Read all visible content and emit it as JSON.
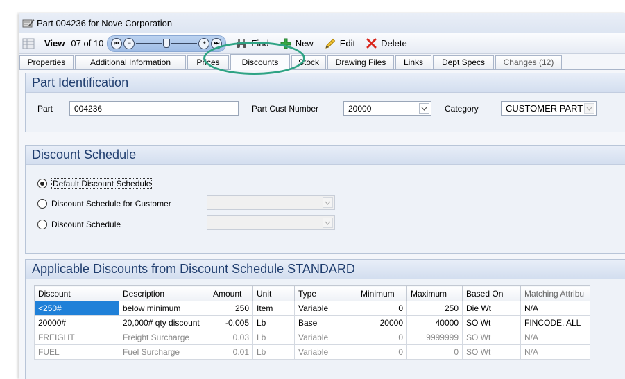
{
  "window": {
    "title": "Part 004236 for Nove Corporation"
  },
  "toolbar": {
    "view_label": "View",
    "record_position": "07 of 10",
    "find_label": "Find",
    "new_label": "New",
    "edit_label": "Edit",
    "delete_label": "Delete"
  },
  "tabs": [
    {
      "label": "Properties"
    },
    {
      "label": "Additional Information"
    },
    {
      "label": "Prices"
    },
    {
      "label": "Discounts"
    },
    {
      "label": "Stock"
    },
    {
      "label": "Drawing Files"
    },
    {
      "label": "Links"
    },
    {
      "label": "Dept Specs"
    },
    {
      "label": "Changes (12)"
    }
  ],
  "active_tab": "Discounts",
  "part_identification": {
    "title": "Part Identification",
    "part_label": "Part",
    "part_value": "004236",
    "cust_number_label": "Part Cust Number",
    "cust_number_value": "20000",
    "category_label": "Category",
    "category_value": "CUSTOMER PART"
  },
  "discount_schedule": {
    "title": "Discount Schedule",
    "options": [
      {
        "label": "Default Discount Schedule",
        "selected": true
      },
      {
        "label": "Discount Schedule for Customer",
        "selected": false
      },
      {
        "label": "Discount Schedule",
        "selected": false
      }
    ]
  },
  "applicable_discounts": {
    "title": "Applicable Discounts from Discount Schedule STANDARD",
    "columns": [
      "Discount",
      "Description",
      "Amount",
      "Unit",
      "Type",
      "Minimum",
      "Maximum",
      "Based On",
      "Matching Attribu"
    ],
    "rows": [
      [
        "<250#",
        "below minimum",
        "250",
        "Item",
        "Variable",
        "0",
        "250",
        "Die Wt",
        "N/A"
      ],
      [
        "20000#",
        "20,000# qty discount",
        "-0.005",
        "Lb",
        "Base",
        "20000",
        "40000",
        "SO Wt",
        "FINCODE, ALL"
      ],
      [
        "FREIGHT",
        "Freight Surcharge",
        "0.03",
        "Lb",
        "Variable",
        "0",
        "9999999",
        "SO Wt",
        "N/A"
      ],
      [
        "FUEL",
        "Fuel Surcharge",
        "0.01",
        "Lb",
        "Variable",
        "0",
        "0",
        "SO Wt",
        "N/A"
      ]
    ]
  },
  "colors": {
    "accent": "#1f80d8",
    "panel_title": "#1f3d6e",
    "highlight_ring": "#2ea384"
  }
}
